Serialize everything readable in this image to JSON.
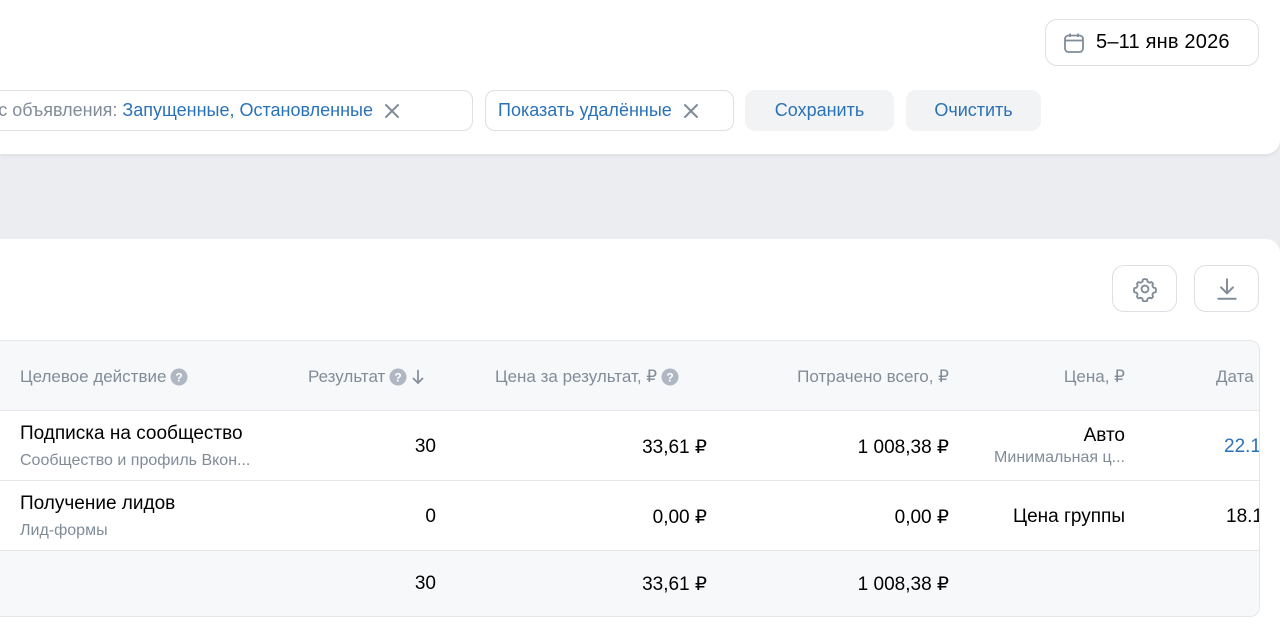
{
  "header": {
    "date_range": "5–11 янв 2026"
  },
  "filters": {
    "status_key": "тус объявления:",
    "status_value": "Запущенные, Остановленные",
    "deleted_value": "Показать удалённые",
    "save_label": "Сохранить",
    "clear_label": "Очистить"
  },
  "table": {
    "columns": {
      "target_action": "Целевое действие",
      "result": "Результат",
      "price_per_result": "Цена за результат, ₽",
      "spent_total": "Потрачено всего, ₽",
      "price": "Цена, ₽",
      "date": "Дата"
    },
    "rows": [
      {
        "action": "Подписка на сообщество",
        "action_sub": "Сообщество и профиль Вкон...",
        "result": "30",
        "price_per_result": "33,61 ₽",
        "spent": "1 008,38 ₽",
        "price": "Авто",
        "price_sub": "Минимальная ц...",
        "date": "22.1"
      },
      {
        "action": "Получение лидов",
        "action_sub": "Лид-формы",
        "result": "0",
        "price_per_result": "0,00 ₽",
        "spent": "0,00 ₽",
        "price": "Цена группы",
        "price_sub": "",
        "date": "18.1"
      }
    ],
    "totals": {
      "result": "30",
      "price_per_result": "33,61 ₽",
      "spent": "1 008,38 ₽"
    }
  },
  "colors": {
    "accent": "#2a72b8",
    "muted": "#818c99",
    "border": "#dcdfe3",
    "page_bg": "#ebedf0"
  },
  "icons": {
    "calendar": "calendar-icon",
    "close": "close-icon",
    "settings": "gear-icon",
    "download": "download-icon",
    "help": "question-icon",
    "sort": "arrow-down-icon"
  }
}
